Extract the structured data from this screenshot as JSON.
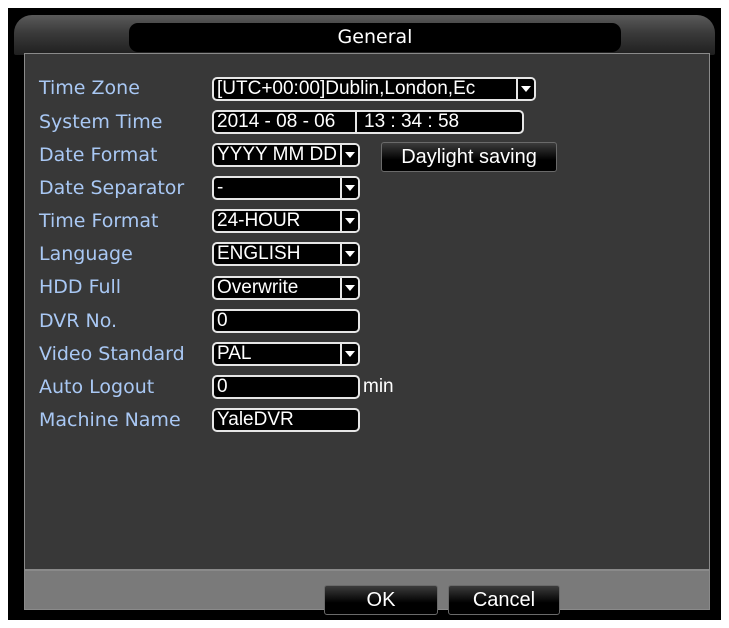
{
  "window": {
    "title": "General"
  },
  "fields": {
    "time_zone": {
      "label": "Time Zone",
      "value": "[UTC+00:00]Dublin,London,Ec"
    },
    "system_time": {
      "label": "System Time",
      "date": "2014 - 08 - 06",
      "time": "13 : 34 : 58"
    },
    "date_format": {
      "label": "Date Format",
      "value": "YYYY MM DD"
    },
    "date_separator": {
      "label": "Date Separator",
      "value": "-"
    },
    "time_format": {
      "label": "Time Format",
      "value": "24-HOUR"
    },
    "language": {
      "label": "Language",
      "value": "ENGLISH"
    },
    "hdd_full": {
      "label": "HDD Full",
      "value": "Overwrite"
    },
    "dvr_no": {
      "label": "DVR No.",
      "value": "0"
    },
    "video_standard": {
      "label": "Video Standard",
      "value": "PAL"
    },
    "auto_logout": {
      "label": "Auto Logout",
      "value": "0",
      "unit": "min"
    },
    "machine_name": {
      "label": "Machine Name",
      "value": "YaleDVR"
    }
  },
  "buttons": {
    "daylight_saving": "Daylight saving",
    "ok": "OK",
    "cancel": "Cancel"
  },
  "icons": {
    "dropdown": "chevron-down-icon"
  },
  "colors": {
    "label": "#a9c8f4",
    "panel": "#383838",
    "field_border": "#e6e6e6"
  }
}
